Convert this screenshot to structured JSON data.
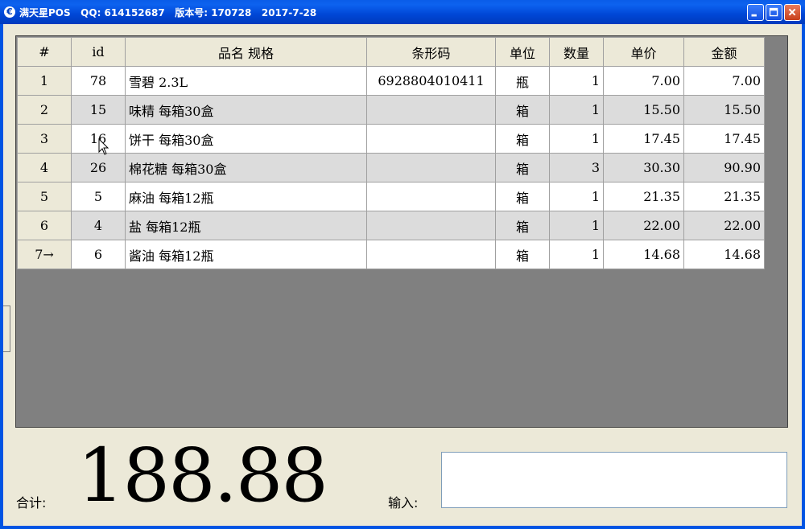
{
  "window": {
    "title": "满天星POS   QQ: 614152687   版本号: 170728   2017-7-28"
  },
  "grid": {
    "columns": [
      "#",
      "id",
      "品名 规格",
      "条形码",
      "单位",
      "数量",
      "单价",
      "金额"
    ],
    "rows": [
      {
        "n": "1",
        "id": "78",
        "name": "雪碧 2.3L",
        "barcode": "6928804010411",
        "unit": "瓶",
        "qty": "1",
        "price": "7.00",
        "amount": "7.00"
      },
      {
        "n": "2",
        "id": "15",
        "name": "味精 每箱30盒",
        "barcode": "",
        "unit": "箱",
        "qty": "1",
        "price": "15.50",
        "amount": "15.50"
      },
      {
        "n": "3",
        "id": "16",
        "name": "饼干 每箱30盒",
        "barcode": "",
        "unit": "箱",
        "qty": "1",
        "price": "17.45",
        "amount": "17.45"
      },
      {
        "n": "4",
        "id": "26",
        "name": "棉花糖 每箱30盒",
        "barcode": "",
        "unit": "箱",
        "qty": "3",
        "price": "30.30",
        "amount": "90.90"
      },
      {
        "n": "5",
        "id": "5",
        "name": "麻油 每箱12瓶",
        "barcode": "",
        "unit": "箱",
        "qty": "1",
        "price": "21.35",
        "amount": "21.35"
      },
      {
        "n": "6",
        "id": "4",
        "name": "盐 每箱12瓶",
        "barcode": "",
        "unit": "箱",
        "qty": "1",
        "price": "22.00",
        "amount": "22.00"
      },
      {
        "n": "7→",
        "id": "6",
        "name": "酱油 每箱12瓶",
        "barcode": "",
        "unit": "箱",
        "qty": "1",
        "price": "14.68",
        "amount": "14.68"
      }
    ]
  },
  "footer": {
    "total_label": "合计:",
    "total_value": "188.88",
    "input_label": "输入:",
    "input_value": ""
  }
}
